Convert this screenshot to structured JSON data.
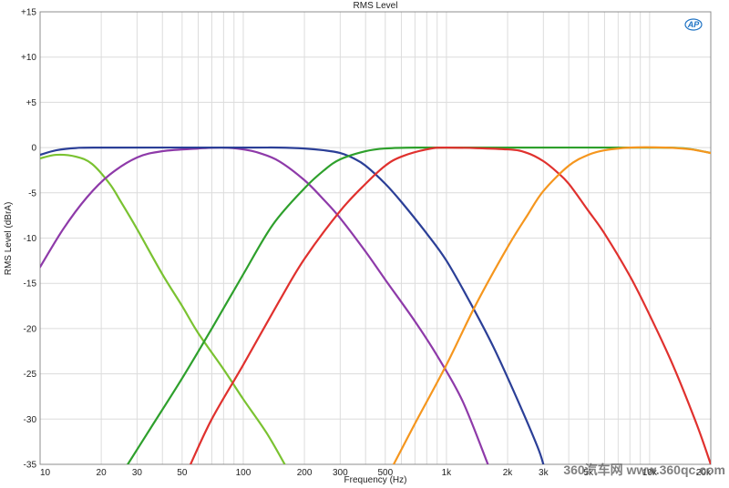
{
  "chart_data": {
    "type": "line",
    "title": "RMS Level",
    "xlabel": "Frequency (Hz)",
    "ylabel": "RMS Level (dBrA)",
    "x_scale": "log",
    "xlim": [
      10,
      20000
    ],
    "ylim": [
      -35,
      15
    ],
    "grid": true,
    "x_ticks": [
      {
        "value": 10,
        "label": "10"
      },
      {
        "value": 20,
        "label": "20"
      },
      {
        "value": 30,
        "label": "30"
      },
      {
        "value": 50,
        "label": "50"
      },
      {
        "value": 100,
        "label": "100"
      },
      {
        "value": 200,
        "label": "200"
      },
      {
        "value": 300,
        "label": "300"
      },
      {
        "value": 500,
        "label": "500"
      },
      {
        "value": 1000,
        "label": "1k"
      },
      {
        "value": 2000,
        "label": "2k"
      },
      {
        "value": 3000,
        "label": "3k"
      },
      {
        "value": 5000,
        "label": "5k"
      },
      {
        "value": 10000,
        "label": "10k"
      },
      {
        "value": 20000,
        "label": "20k"
      }
    ],
    "y_ticks": [
      {
        "value": 15,
        "label": "+15"
      },
      {
        "value": 10,
        "label": "+10"
      },
      {
        "value": 5,
        "label": "+5"
      },
      {
        "value": 0,
        "label": "0"
      },
      {
        "value": -5,
        "label": "-5"
      },
      {
        "value": -10,
        "label": "-10"
      },
      {
        "value": -15,
        "label": "-15"
      },
      {
        "value": -20,
        "label": "-20"
      },
      {
        "value": -25,
        "label": "-25"
      },
      {
        "value": -30,
        "label": "-30"
      },
      {
        "value": -35,
        "label": "-35"
      }
    ],
    "series": [
      {
        "color": "#7ac231",
        "points": [
          [
            10,
            -1.2
          ],
          [
            12,
            -0.8
          ],
          [
            15,
            -1.0
          ],
          [
            18,
            -1.8
          ],
          [
            22,
            -4
          ],
          [
            25,
            -6
          ],
          [
            30,
            -9
          ],
          [
            40,
            -14
          ],
          [
            50,
            -17.5
          ],
          [
            60,
            -20.5
          ],
          [
            80,
            -24.5
          ],
          [
            100,
            -27.8
          ],
          [
            130,
            -31.5
          ],
          [
            160,
            -35
          ]
        ]
      },
      {
        "color": "#8e3aa9",
        "points": [
          [
            10,
            -13.2
          ],
          [
            13,
            -9
          ],
          [
            17,
            -5.5
          ],
          [
            22,
            -3
          ],
          [
            30,
            -1.1
          ],
          [
            40,
            -0.4
          ],
          [
            60,
            -0.1
          ],
          [
            80,
            0
          ],
          [
            100,
            -0.2
          ],
          [
            120,
            -0.6
          ],
          [
            150,
            -1.5
          ],
          [
            200,
            -3.6
          ],
          [
            250,
            -5.8
          ],
          [
            300,
            -7.8
          ],
          [
            400,
            -11.5
          ],
          [
            500,
            -14.6
          ],
          [
            700,
            -19.2
          ],
          [
            900,
            -23
          ],
          [
            1200,
            -28
          ],
          [
            1600,
            -35
          ]
        ]
      },
      {
        "color": "#2b3f97",
        "points": [
          [
            10,
            -0.8
          ],
          [
            12,
            -0.3
          ],
          [
            15,
            -0.05
          ],
          [
            20,
            0
          ],
          [
            100,
            0
          ],
          [
            150,
            0
          ],
          [
            200,
            -0.1
          ],
          [
            250,
            -0.3
          ],
          [
            300,
            -0.6
          ],
          [
            350,
            -1.2
          ],
          [
            400,
            -2
          ],
          [
            500,
            -4
          ],
          [
            600,
            -6
          ],
          [
            800,
            -9.5
          ],
          [
            1000,
            -12.5
          ],
          [
            1300,
            -17
          ],
          [
            1700,
            -22
          ],
          [
            2200,
            -27.5
          ],
          [
            2800,
            -33
          ],
          [
            3000,
            -35
          ]
        ]
      },
      {
        "color": "#2ea02c",
        "points": [
          [
            27,
            -35
          ],
          [
            35,
            -31
          ],
          [
            50,
            -25.5
          ],
          [
            70,
            -20
          ],
          [
            100,
            -14
          ],
          [
            140,
            -8.5
          ],
          [
            200,
            -4.5
          ],
          [
            250,
            -2.5
          ],
          [
            300,
            -1.3
          ],
          [
            400,
            -0.4
          ],
          [
            500,
            -0.1
          ],
          [
            700,
            0
          ],
          [
            2000,
            0
          ],
          [
            10000,
            0
          ],
          [
            15000,
            -0.1
          ],
          [
            20000,
            -0.6
          ]
        ]
      },
      {
        "color": "#e0312e",
        "points": [
          [
            55,
            -35
          ],
          [
            70,
            -30
          ],
          [
            100,
            -24
          ],
          [
            150,
            -17
          ],
          [
            200,
            -12.3
          ],
          [
            300,
            -7
          ],
          [
            400,
            -4
          ],
          [
            500,
            -2
          ],
          [
            600,
            -1
          ],
          [
            800,
            -0.2
          ],
          [
            1000,
            0
          ],
          [
            2000,
            -0.2
          ],
          [
            2500,
            -0.6
          ],
          [
            3000,
            -1.5
          ],
          [
            3500,
            -2.7
          ],
          [
            4000,
            -4
          ],
          [
            5000,
            -7
          ],
          [
            6000,
            -9.5
          ],
          [
            8000,
            -14.2
          ],
          [
            10000,
            -18.5
          ],
          [
            13000,
            -24
          ],
          [
            17000,
            -30.5
          ],
          [
            20000,
            -35
          ]
        ]
      },
      {
        "color": "#f5961e",
        "points": [
          [
            550,
            -35
          ],
          [
            700,
            -30.5
          ],
          [
            1000,
            -24
          ],
          [
            1400,
            -17.3
          ],
          [
            2000,
            -11
          ],
          [
            2500,
            -7.5
          ],
          [
            3000,
            -4.8
          ],
          [
            4000,
            -2
          ],
          [
            5000,
            -0.8
          ],
          [
            6000,
            -0.3
          ],
          [
            8000,
            0
          ],
          [
            12000,
            0
          ],
          [
            16000,
            -0.2
          ],
          [
            20000,
            -0.6
          ]
        ]
      }
    ]
  },
  "logo_text": "AP",
  "watermark_text": "360汽车网 www.360qc.com"
}
